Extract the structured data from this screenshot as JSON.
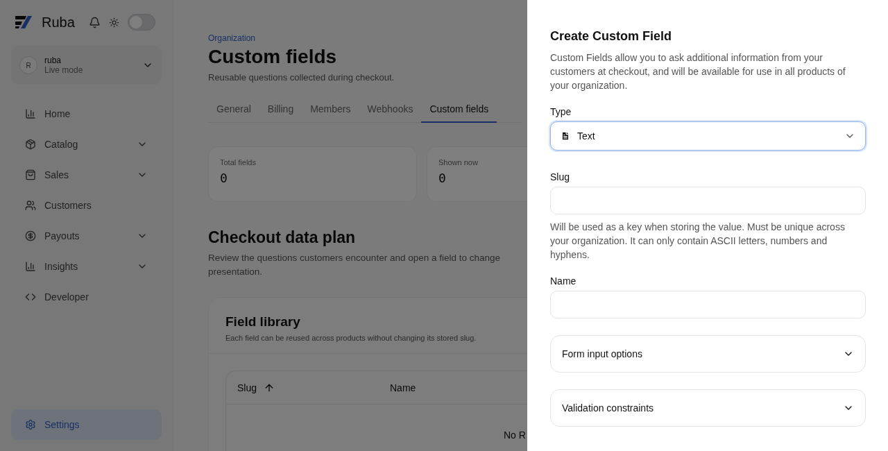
{
  "sidebar": {
    "brand": "Ruba",
    "theme_toggle": {
      "on": false
    },
    "account": {
      "avatar": "R",
      "name": "ruba",
      "mode": "Live mode"
    },
    "items": [
      {
        "label": "Home",
        "expandable": false,
        "selected": false
      },
      {
        "label": "Catalog",
        "expandable": true,
        "selected": false
      },
      {
        "label": "Sales",
        "expandable": true,
        "selected": false
      },
      {
        "label": "Customers",
        "expandable": false,
        "selected": false
      },
      {
        "label": "Payouts",
        "expandable": true,
        "selected": false
      },
      {
        "label": "Insights",
        "expandable": true,
        "selected": false
      },
      {
        "label": "Developer",
        "expandable": false,
        "selected": false
      }
    ],
    "settings": {
      "label": "Settings",
      "selected": true
    }
  },
  "main": {
    "breadcrumb": "Organization",
    "title": "Custom fields",
    "subtitle": "Reusable questions collected during checkout.",
    "tabs": [
      {
        "label": "General",
        "selected": false
      },
      {
        "label": "Billing",
        "selected": false
      },
      {
        "label": "Members",
        "selected": false
      },
      {
        "label": "Webhooks",
        "selected": false
      },
      {
        "label": "Custom fields",
        "selected": true
      }
    ],
    "stats": [
      {
        "label": "Total fields",
        "value": "0"
      },
      {
        "label": "Shown now",
        "value": "0"
      }
    ],
    "section": {
      "title": "Checkout data plan",
      "description": "Review the questions customers encounter and open a field to change presentation."
    },
    "library": {
      "title": "Field library",
      "description": "Each field can be reused across products without changing its stored slug.",
      "columns": [
        {
          "label": "Slug",
          "sorted": true
        },
        {
          "label": "Name",
          "sorted": false
        }
      ],
      "empty_text": "No R"
    }
  },
  "drawer": {
    "title": "Create Custom Field",
    "description": "Custom Fields allow you to ask additional information from your customers at checkout, and will be available for use in all products of your organization.",
    "type": {
      "label": "Type",
      "value": "Text",
      "focused": true
    },
    "slug": {
      "label": "Slug",
      "help": "Will be used as a key when storing the value. Must be unique across your organization. It can only contain ASCII letters, numbers and hyphens."
    },
    "name": {
      "label": "Name"
    },
    "sections": [
      {
        "label": "Form input options",
        "expanded": false
      },
      {
        "label": "Validation constraints",
        "expanded": false
      }
    ]
  }
}
